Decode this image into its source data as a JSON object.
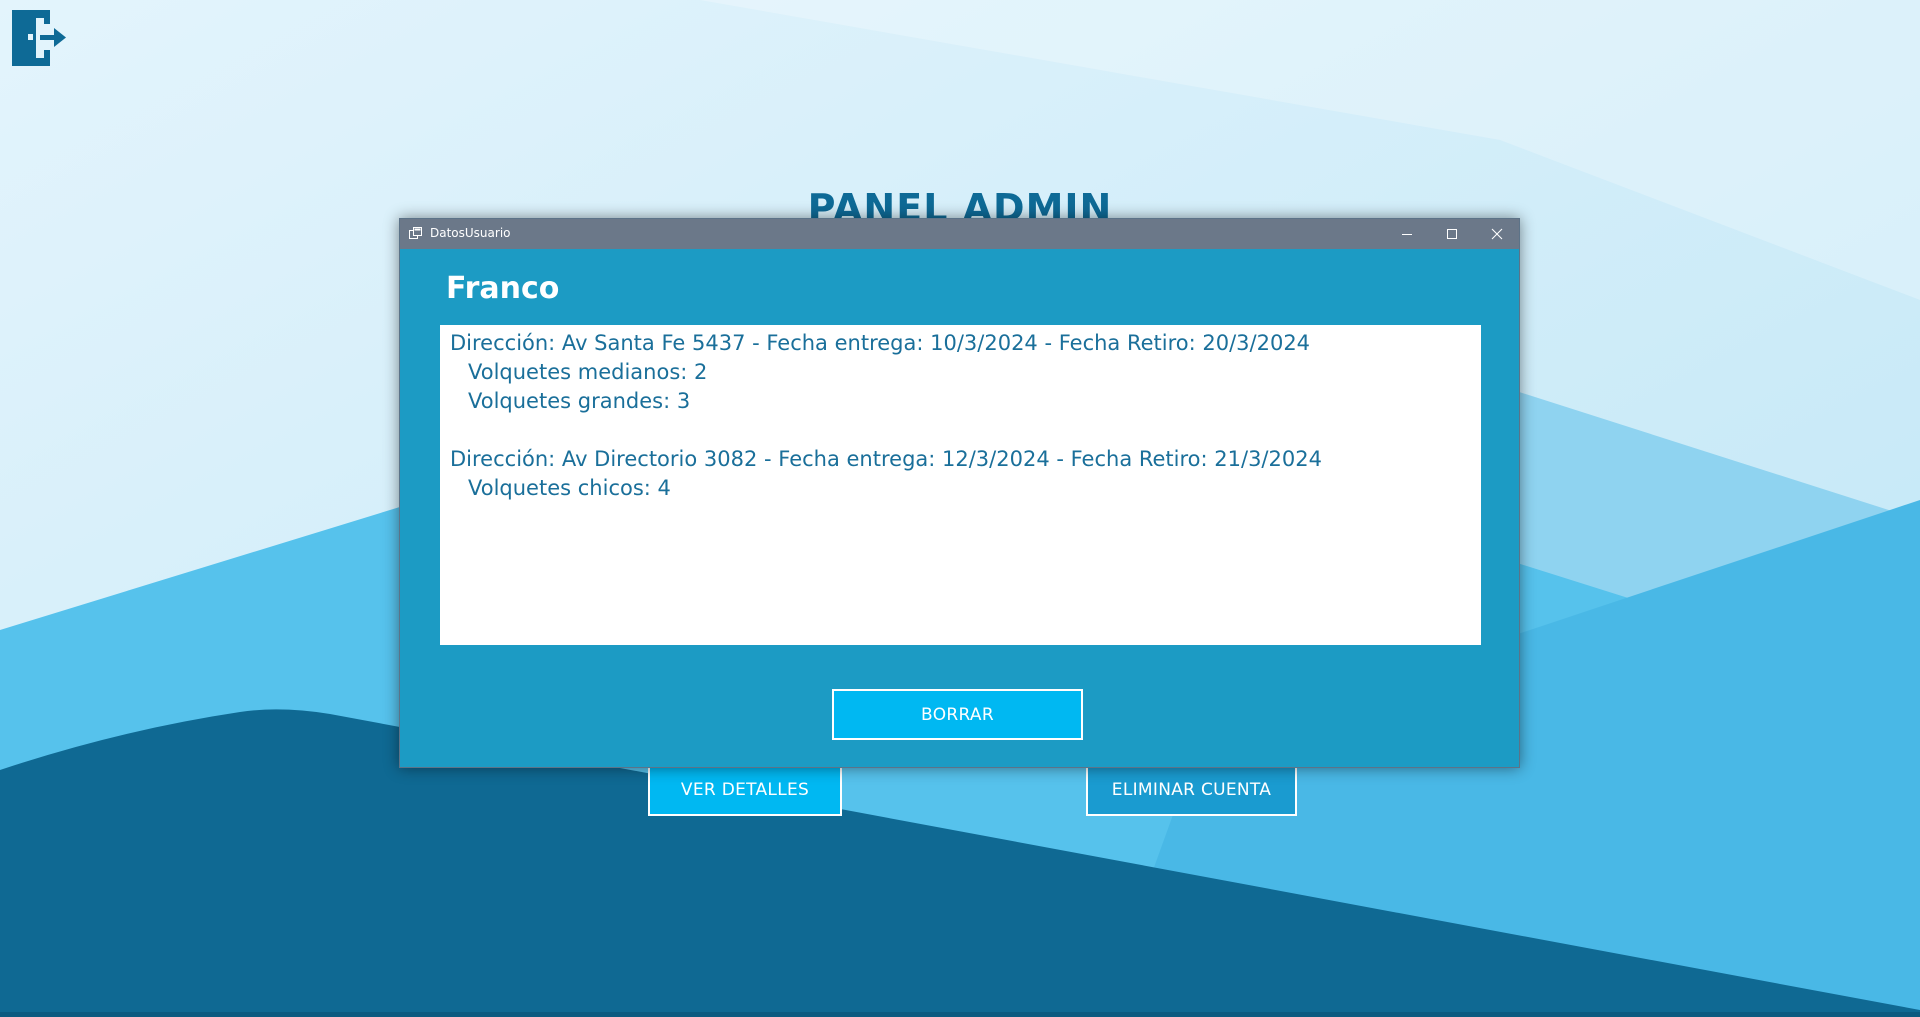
{
  "background": {
    "panel_title": "PANEL ADMIN",
    "exit_icon": "exit-door-icon",
    "ver_detalles_label": "VER DETALLES",
    "eliminar_cuenta_label": "ELIMINAR CUENTA"
  },
  "dialog": {
    "window_title": "DatosUsuario",
    "user_name": "Franco",
    "details": {
      "line1": "Dirección: Av Santa Fe 5437 - Fecha entrega: 10/3/2024 - Fecha Retiro: 20/3/2024",
      "line2": "Volquetes medianos: 2",
      "line3": "Volquetes grandes: 3",
      "line4": "Dirección: Av Directorio 3082 - Fecha entrega: 12/3/2024 - Fecha Retiro: 21/3/2024",
      "line5": "Volquetes chicos: 4"
    },
    "borrar_label": "BORRAR"
  },
  "colors": {
    "dialog_background": "#1c9bc4",
    "button_fill": "#00b8f2",
    "title_text": "#0e6a96",
    "detail_text": "#1a6f9a",
    "titlebar": "#6b7889"
  }
}
